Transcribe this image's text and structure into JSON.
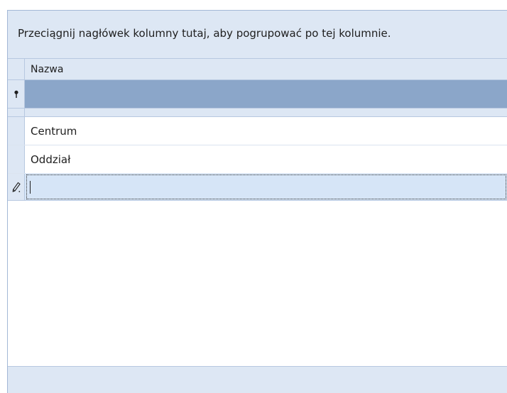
{
  "group_panel": {
    "hint": "Przeciągnij nagłówek kolumny tutaj, aby pogrupować po tej kolumnie."
  },
  "columns": [
    {
      "header": "Nazwa"
    }
  ],
  "filter_row": {
    "value": "",
    "icon": "filter-pin-icon"
  },
  "rows": [
    {
      "nazwa": "Centrum"
    },
    {
      "nazwa": "Oddział"
    }
  ],
  "new_row": {
    "value": "",
    "icon": "edit-pencil-icon"
  },
  "colors": {
    "panel_background": "#dde7f4",
    "filter_row_background": "#8ba6c9",
    "new_row_background": "#d6e5f7",
    "border": "#b7c8e0"
  }
}
